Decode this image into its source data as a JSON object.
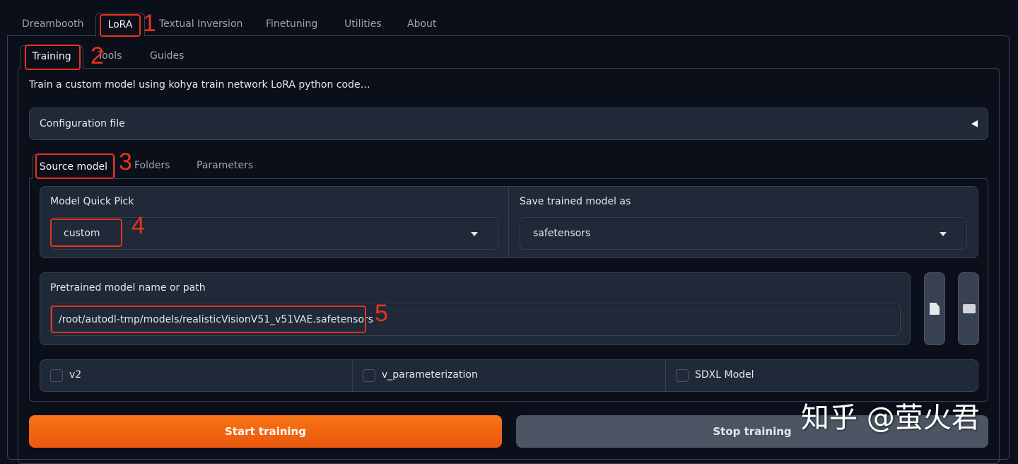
{
  "top_tabs": [
    "Dreambooth",
    "LoRA",
    "Textual Inversion",
    "Finetuning",
    "Utilities",
    "About"
  ],
  "sub_tabs": [
    "Training",
    "Tools",
    "Guides"
  ],
  "description": "Train a custom model using kohya train network LoRA python code…",
  "config_accordion": {
    "label": "Configuration file",
    "icon": "triangle-left-icon"
  },
  "section_tabs": [
    "Source model",
    "Folders",
    "Parameters"
  ],
  "model_quick_pick": {
    "label": "Model Quick Pick",
    "value": "custom"
  },
  "save_as": {
    "label": "Save trained model as",
    "value": "safetensors"
  },
  "pretrained": {
    "label": "Pretrained model name or path",
    "value": "/root/autodl-tmp/models/realisticVisionV51_v51VAE.safetensors",
    "file_icon": "file-icon",
    "folder_icon": "folder-icon"
  },
  "checkboxes": [
    {
      "label": "v2",
      "checked": false
    },
    {
      "label": "v_parameterization",
      "checked": false
    },
    {
      "label": "SDXL Model",
      "checked": false
    }
  ],
  "buttons": {
    "start": "Start training",
    "stop": "Stop training"
  },
  "annotations": [
    "1",
    "2",
    "3",
    "4",
    "5"
  ],
  "watermark": "知乎 @萤火君",
  "colors": {
    "accent": "#f97316",
    "annotation": "#e8321e",
    "background": "#0b0f19"
  }
}
